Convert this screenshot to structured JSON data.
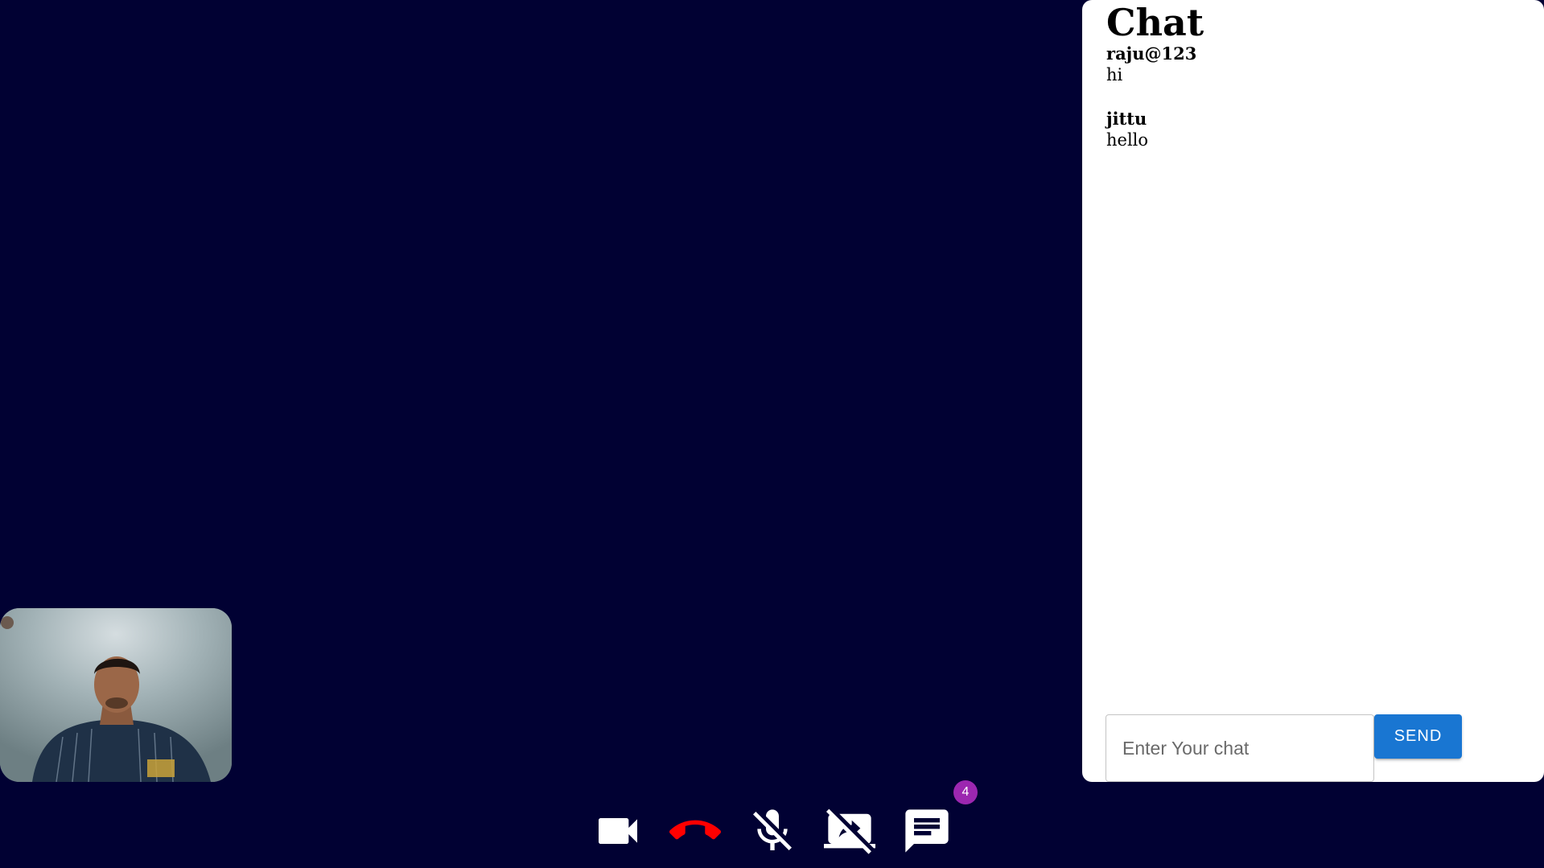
{
  "chat": {
    "title": "Chat",
    "messages": [
      {
        "sender": "raju@123",
        "text": "hi"
      },
      {
        "sender": "jittu",
        "text": "hello"
      }
    ],
    "input": {
      "placeholder": "Enter Your chat",
      "value": ""
    },
    "send_label": "SEND"
  },
  "toolbar": {
    "buttons": [
      {
        "icon": "videocam-icon"
      },
      {
        "icon": "call-end-icon",
        "color": "#ff0000"
      },
      {
        "icon": "mic-off-icon"
      },
      {
        "icon": "screen-share-off-icon"
      },
      {
        "icon": "chat-icon"
      }
    ],
    "chat_badge_count": "4"
  },
  "colors": {
    "background": "#010133",
    "accent": "#1976d2",
    "badge": "#9c27b0",
    "end_call": "#ff0000"
  }
}
